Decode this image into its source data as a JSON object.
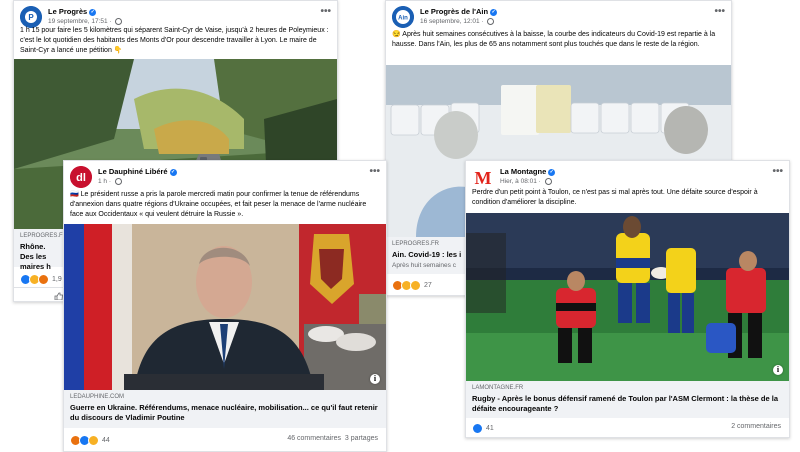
{
  "cards": [
    {
      "page_name": "Le Progrès",
      "timestamp": "19 septembre, 17:51",
      "text": "1 h 15 pour faire les 5 kilomètres qui séparent Saint-Cyr de Vaise, jusqu'à 2 heures de Poleymieux : c'est le lot quotidien des habitants des Monts d'Or pour descendre travailler à Lyon. Le maire de Saint-Cyr a lancé une pétition 👇",
      "link_domain": "LEPROGRES.FR",
      "link_title": "Rhône. Des les maires h",
      "reaction_count": "1,9",
      "avatar_color": "#1a5fb4"
    },
    {
      "page_name": "Le Progrès de l'Ain",
      "timestamp": "16 septembre, 12:01",
      "text": "😏 Après huit semaines consécutives à la baisse, la courbe des indicateurs du Covid-19 est repartie à la hausse. Dans l'Ain, les plus de 65 ans notamment sont plus touchés que dans le reste de la région.",
      "link_domain": "LEPROGRES.FR",
      "link_title": "Ain. Covid-19 : les i",
      "link_sub": "Après huit semaines c",
      "reaction_count": "27",
      "avatar_color": "#1a5fb4"
    },
    {
      "page_name": "Le Dauphiné Libéré",
      "timestamp": "1 h",
      "text": "🇷🇺 Le président russe a pris la parole mercredi matin pour confirmer la tenue de référendums d'annexion dans quatre régions d'Ukraine occupées, et fait peser la menace de l'arme nucléaire face aux Occidentaux « qui veulent détruire la Russie ».",
      "link_domain": "LEDAUPHINE.COM",
      "link_title": "Guerre en Ukraine. Référendums, menace nucléaire, mobilisation... ce qu'il faut retenir du discours de Vladimir Poutine",
      "reaction_count": "44",
      "comments": "46 commentaires",
      "shares": "3 partages",
      "avatar_color": "#c8102e"
    },
    {
      "page_name": "La Montagne",
      "timestamp": "Hier, à 08:01",
      "text": "Perdre d'un petit point à Toulon, ce n'est pas si mal après tout. Une défaite source d'espoir à condition d'améliorer la discipline.",
      "link_domain": "LAMONTAGNE.FR",
      "link_title": "Rugby - Après le bonus défensif ramené de Toulon par l'ASM Clermont : la thèse de la défaite encourageante ?",
      "reaction_count": "41",
      "comments": "2 commentaires",
      "avatar_letter": "M",
      "avatar_color": "#e2231a"
    }
  ],
  "icons": {
    "more": "•••",
    "info": "i",
    "verified": "✓"
  }
}
